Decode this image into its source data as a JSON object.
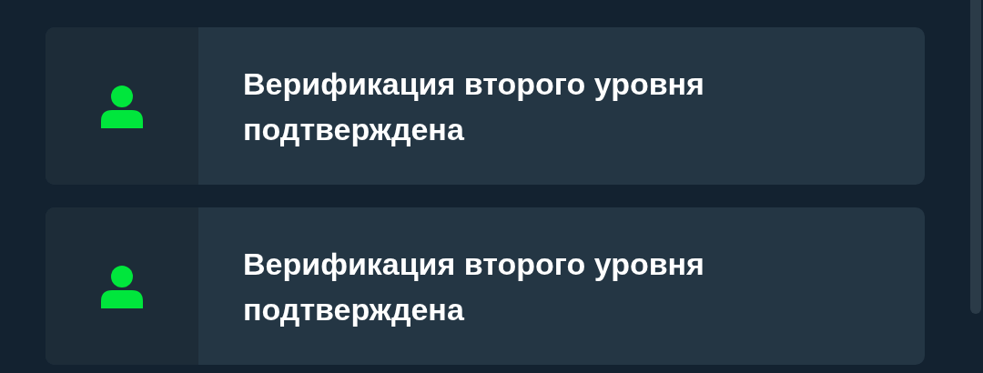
{
  "notifications": [
    {
      "text": "Верификация второго уровня подтверждена"
    },
    {
      "text": "Верификация второго уровня подтверждена"
    }
  ]
}
